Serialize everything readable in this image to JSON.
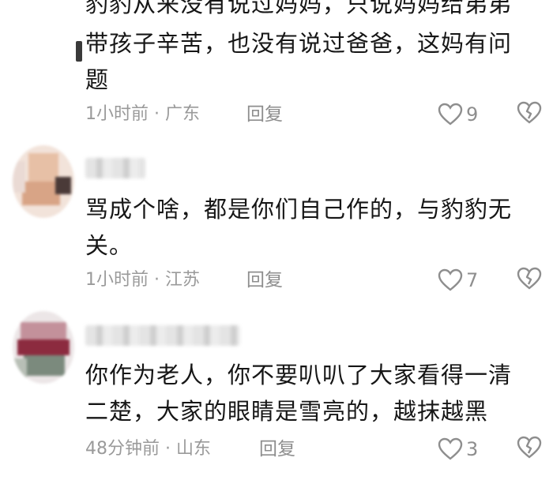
{
  "comments": [
    {
      "top_partial": "豹豹从来没有说过妈妈，只说妈妈给弟弟",
      "text_line1": "带孩子辛苦，也没有说过爸爸，这妈有问",
      "text_line2": "题",
      "time": "1小时前",
      "region": "广东",
      "reply_label": "回复",
      "likes": "9"
    },
    {
      "text_line1": "骂成个啥，都是你们自己作的，与豹豹无",
      "text_line2": "关。",
      "time": "1小时前",
      "region": "江苏",
      "reply_label": "回复",
      "likes": "7"
    },
    {
      "text_line1": "你作为老人，你不要叭叭了大家看得一清",
      "text_line2": "二楚，大家的眼睛是雪亮的，越抹越黑",
      "time": "48分钟前",
      "region": "山东",
      "reply_label": "回复",
      "likes": "3"
    }
  ],
  "separator": " · ",
  "icons": {
    "like": "heart-outline-icon",
    "dislike": "broken-heart-icon"
  },
  "colors": {
    "text": "#161616",
    "meta": "#9a9a9a",
    "icon": "#8e8e8e"
  }
}
